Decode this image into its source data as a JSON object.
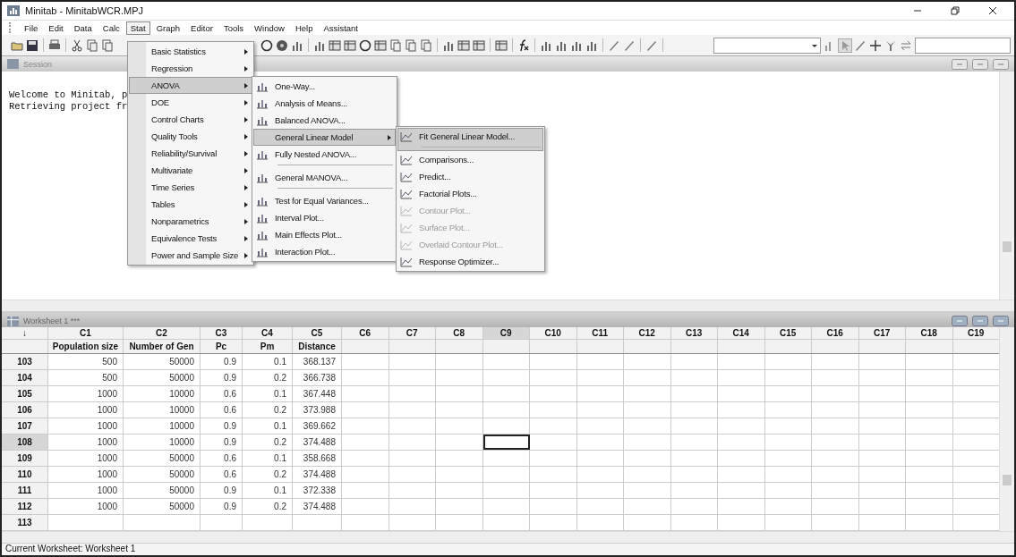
{
  "window": {
    "title": "Minitab - MinitabWCR.MPJ"
  },
  "menubar": [
    {
      "label": "File",
      "selected": false
    },
    {
      "label": "Edit",
      "selected": false
    },
    {
      "label": "Data",
      "selected": false
    },
    {
      "label": "Calc",
      "selected": false
    },
    {
      "label": "Stat",
      "selected": true
    },
    {
      "label": "Graph",
      "selected": false
    },
    {
      "label": "Editor",
      "selected": false
    },
    {
      "label": "Tools",
      "selected": false
    },
    {
      "label": "Window",
      "selected": false
    },
    {
      "label": "Help",
      "selected": false
    },
    {
      "label": "Assistant",
      "selected": false
    }
  ],
  "session": {
    "title": "Session",
    "lines": [
      "Welcome to Minitab, p",
      "Retrieving project fr"
    ]
  },
  "stat_menu": [
    {
      "label": "Basic Statistics",
      "selected": false
    },
    {
      "label": "Regression",
      "selected": false
    },
    {
      "label": "ANOVA",
      "selected": true
    },
    {
      "label": "DOE",
      "selected": false
    },
    {
      "label": "Control Charts",
      "selected": false
    },
    {
      "label": "Quality Tools",
      "selected": false
    },
    {
      "label": "Reliability/Survival",
      "selected": false
    },
    {
      "label": "Multivariate",
      "selected": false
    },
    {
      "label": "Time Series",
      "selected": false
    },
    {
      "label": "Tables",
      "selected": false
    },
    {
      "label": "Nonparametrics",
      "selected": false
    },
    {
      "label": "Equivalence Tests",
      "selected": false
    },
    {
      "label": "Power and Sample Size",
      "selected": false
    }
  ],
  "anova_menu": [
    {
      "label": "One-Way...",
      "selected": false,
      "has_icon": true,
      "submenu": false,
      "separator_after": false
    },
    {
      "label": "Analysis of Means...",
      "selected": false,
      "has_icon": true,
      "submenu": false,
      "separator_after": false
    },
    {
      "label": "Balanced ANOVA...",
      "selected": false,
      "has_icon": true,
      "submenu": false,
      "separator_after": false
    },
    {
      "label": "General Linear Model",
      "selected": true,
      "has_icon": false,
      "submenu": true,
      "separator_after": false
    },
    {
      "label": "Fully Nested ANOVA...",
      "selected": false,
      "has_icon": true,
      "submenu": false,
      "separator_after": true
    },
    {
      "label": "General MANOVA...",
      "selected": false,
      "has_icon": true,
      "submenu": false,
      "separator_after": true
    },
    {
      "label": "Test for Equal Variances...",
      "selected": false,
      "has_icon": true,
      "submenu": false,
      "separator_after": false
    },
    {
      "label": "Interval Plot...",
      "selected": false,
      "has_icon": true,
      "submenu": false,
      "separator_after": false
    },
    {
      "label": "Main Effects Plot...",
      "selected": false,
      "has_icon": true,
      "submenu": false,
      "separator_after": false
    },
    {
      "label": "Interaction Plot...",
      "selected": false,
      "has_icon": true,
      "submenu": false,
      "separator_after": false
    }
  ],
  "glm_menu": [
    {
      "label": "Fit General Linear Model...",
      "selected": true,
      "disabled": false,
      "separator_after": true
    },
    {
      "label": "Comparisons...",
      "selected": false,
      "disabled": false,
      "separator_after": false
    },
    {
      "label": "Predict...",
      "selected": false,
      "disabled": false,
      "separator_after": false
    },
    {
      "label": "Factorial Plots...",
      "selected": false,
      "disabled": false,
      "separator_after": false
    },
    {
      "label": "Contour Plot...",
      "selected": false,
      "disabled": true,
      "separator_after": false
    },
    {
      "label": "Surface Plot...",
      "selected": false,
      "disabled": true,
      "separator_after": false
    },
    {
      "label": "Overlaid Contour Plot...",
      "selected": false,
      "disabled": true,
      "separator_after": false
    },
    {
      "label": "Response Optimizer...",
      "selected": false,
      "disabled": false,
      "separator_after": false
    }
  ],
  "worksheet": {
    "title": "Worksheet 1 ***",
    "corner": "↓",
    "columns": [
      {
        "id": "C1",
        "name": "Population size",
        "active": false
      },
      {
        "id": "C2",
        "name": "Number of Gen",
        "active": false
      },
      {
        "id": "C3",
        "name": "Pc",
        "active": false
      },
      {
        "id": "C4",
        "name": "Pm",
        "active": false
      },
      {
        "id": "C5",
        "name": "Distance",
        "active": false
      },
      {
        "id": "C6",
        "active": false
      },
      {
        "id": "C7",
        "active": false
      },
      {
        "id": "C8",
        "active": false
      },
      {
        "id": "C9",
        "active": true
      },
      {
        "id": "C10",
        "active": false
      },
      {
        "id": "C11",
        "active": false
      },
      {
        "id": "C12",
        "active": false
      },
      {
        "id": "C13",
        "active": false
      },
      {
        "id": "C14",
        "active": false
      },
      {
        "id": "C15",
        "active": false
      },
      {
        "id": "C16",
        "active": false
      },
      {
        "id": "C17",
        "active": false
      },
      {
        "id": "C18",
        "active": false
      },
      {
        "id": "C19",
        "active": false
      }
    ],
    "rows": [
      {
        "number": "103",
        "active": false,
        "cells": [
          "500",
          "50000",
          "0.9",
          "0.1",
          "368.137"
        ]
      },
      {
        "number": "104",
        "active": false,
        "cells": [
          "500",
          "50000",
          "0.9",
          "0.2",
          "366.738"
        ]
      },
      {
        "number": "105",
        "active": false,
        "cells": [
          "1000",
          "10000",
          "0.6",
          "0.1",
          "367.448"
        ]
      },
      {
        "number": "106",
        "active": false,
        "cells": [
          "1000",
          "10000",
          "0.6",
          "0.2",
          "373.988"
        ]
      },
      {
        "number": "107",
        "active": false,
        "cells": [
          "1000",
          "10000",
          "0.9",
          "0.1",
          "369.662"
        ]
      },
      {
        "number": "108",
        "active": true,
        "cells": [
          "1000",
          "10000",
          "0.9",
          "0.2",
          "374.488"
        ]
      },
      {
        "number": "109",
        "active": false,
        "cells": [
          "1000",
          "50000",
          "0.6",
          "0.1",
          "358.668"
        ]
      },
      {
        "number": "110",
        "active": false,
        "cells": [
          "1000",
          "50000",
          "0.6",
          "0.2",
          "374.488"
        ]
      },
      {
        "number": "111",
        "active": false,
        "cells": [
          "1000",
          "50000",
          "0.9",
          "0.1",
          "372.338"
        ]
      },
      {
        "number": "112",
        "active": false,
        "cells": [
          "1000",
          "50000",
          "0.9",
          "0.2",
          "374.488"
        ]
      },
      {
        "number": "113",
        "active": false
      }
    ]
  },
  "status_bar": {
    "text": "Current Worksheet: Worksheet 1"
  }
}
